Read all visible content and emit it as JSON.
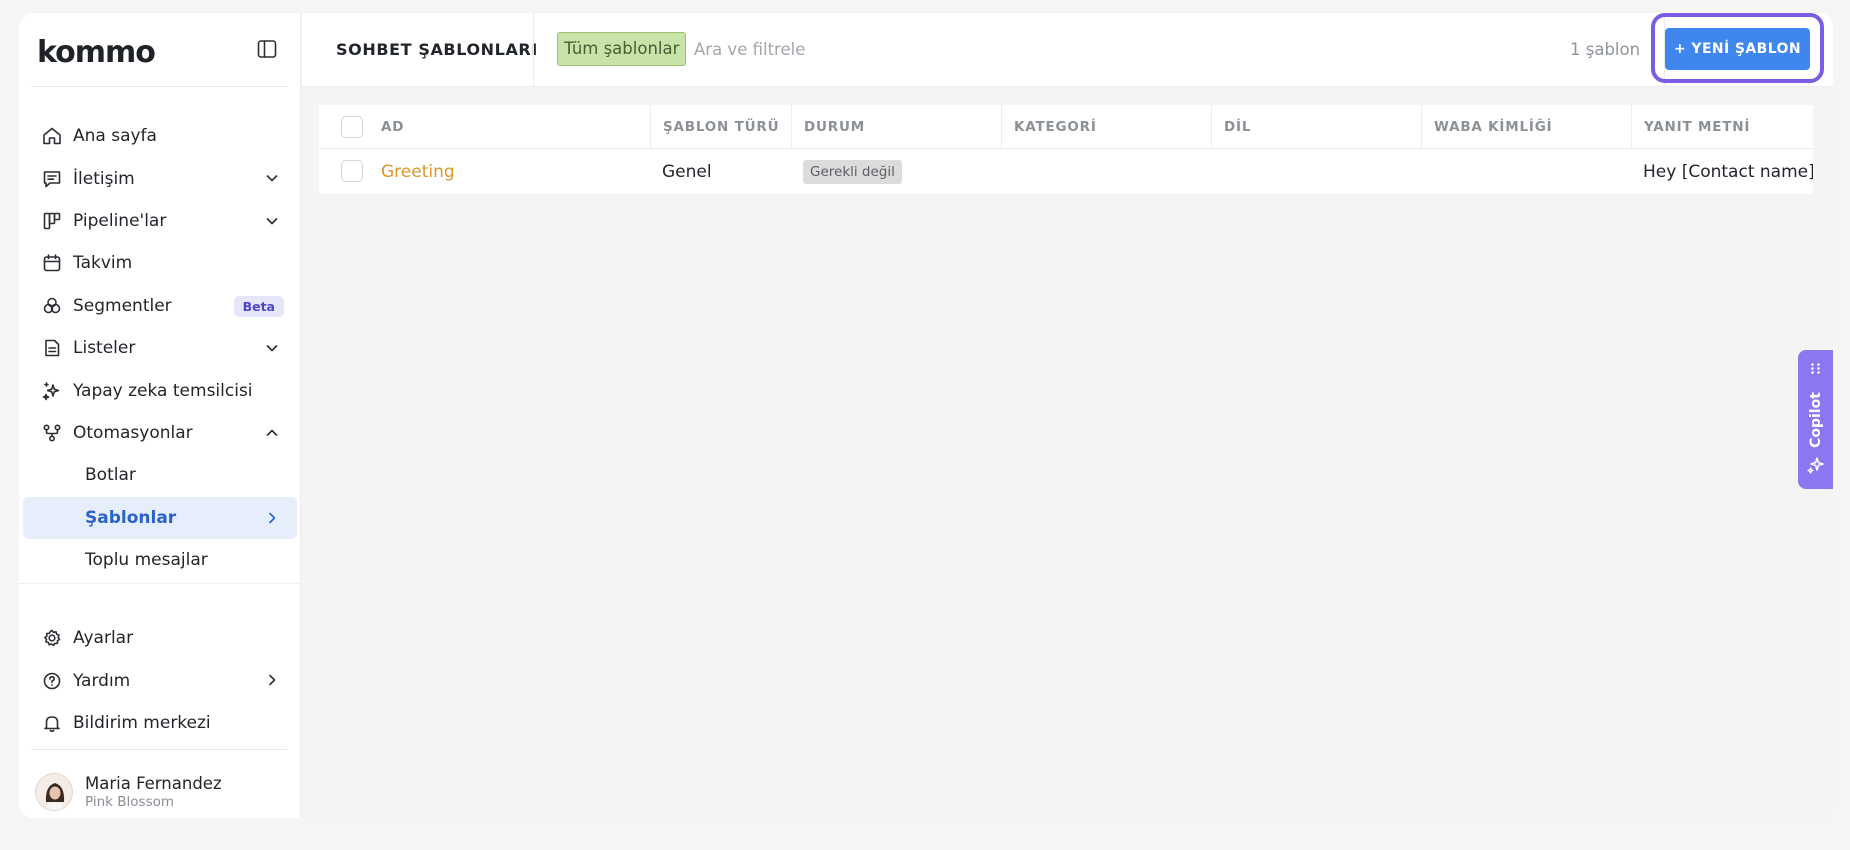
{
  "brand": {
    "logo_text": "kommo"
  },
  "sidebar": {
    "items": [
      {
        "label": "Ana sayfa",
        "icon": "home-icon"
      },
      {
        "label": "İletişim",
        "icon": "chat-icon",
        "chevron": "down"
      },
      {
        "label": "Pipeline'lar",
        "icon": "pipeline-icon",
        "chevron": "down"
      },
      {
        "label": "Takvim",
        "icon": "calendar-icon"
      },
      {
        "label": "Segmentler",
        "icon": "segments-icon",
        "badge": "Beta"
      },
      {
        "label": "Listeler",
        "icon": "list-icon",
        "chevron": "down"
      },
      {
        "label": "Yapay zeka temsilcisi",
        "icon": "sparkle-icon"
      },
      {
        "label": "Otomasyonlar",
        "icon": "automation-icon",
        "chevron": "up"
      }
    ],
    "subitems": [
      {
        "label": "Botlar"
      },
      {
        "label": "Şablonlar",
        "active": true
      },
      {
        "label": "Toplu mesajlar"
      }
    ],
    "bottom_items": [
      {
        "label": "Ayarlar",
        "icon": "gear-icon"
      },
      {
        "label": "Yardım",
        "icon": "help-icon",
        "chevron": "right"
      },
      {
        "label": "Bildirim merkezi",
        "icon": "bell-icon"
      }
    ],
    "profile": {
      "name": "Maria Fernandez",
      "org": "Pink Blossom"
    }
  },
  "header": {
    "title": "SOHBET ŞABLONLARI",
    "filter_chip": "Tüm şablonlar",
    "search_placeholder": "Ara ve filtrele",
    "count": "1 şablon",
    "new_button": "+ YENİ ŞABLON"
  },
  "table": {
    "columns": [
      "AD",
      "ŞABLON TÜRÜ",
      "DURUM",
      "KATEGORİ",
      "DİL",
      "WABA KİMLİĞİ",
      "YANIT METNİ"
    ],
    "rows": [
      {
        "name": "Greeting",
        "type": "Genel",
        "status": "Gerekli değil",
        "category": "",
        "language": "",
        "waba_id": "",
        "reply": "Hey [Contact name]! Th"
      }
    ]
  },
  "copilot": {
    "label": "Copilot"
  },
  "colors": {
    "accent": "#3f86ef",
    "highlight_border": "#7b5ce6",
    "link": "#e0942a",
    "filter_chip": "#c8e3a8",
    "active_nav": "#2a62c9",
    "copilot": "#8d77f0"
  }
}
